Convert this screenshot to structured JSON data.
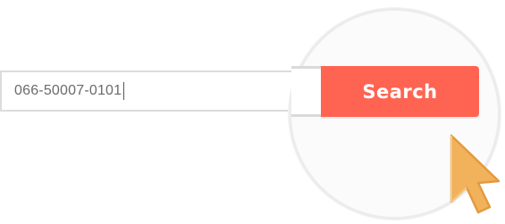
{
  "search": {
    "value": "066-50007-0101",
    "button_label": "Search"
  },
  "icons": {
    "cursor": "mouse-pointer-icon"
  },
  "colors": {
    "button": "#ff6452",
    "button_text": "#ffffff",
    "input_border": "#dcdcdc",
    "input_text": "#6b6b6b",
    "cursor_fill": "#f2b25c",
    "cursor_stroke": "#e39a3e"
  }
}
